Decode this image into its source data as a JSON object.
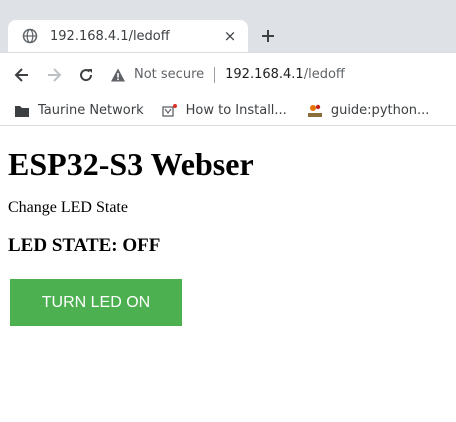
{
  "browser": {
    "tab": {
      "title": "192.168.4.1/ledoff",
      "close_glyph": "×",
      "icon": "globe-icon"
    },
    "new_tab_icon": "plus-icon",
    "address": {
      "security_label": "Not secure",
      "host": "192.168.4.1",
      "path": "/ledoff"
    },
    "bookmarks": [
      {
        "label": "Taurine Network",
        "icon": "folder-icon"
      },
      {
        "label": "How to Install...",
        "icon": "favicon-icon"
      },
      {
        "label": "guide:python...",
        "icon": "chpc-favicon-icon"
      }
    ]
  },
  "page": {
    "heading": "ESP32-S3 Webser",
    "subtitle": "Change LED State",
    "led_state": "LED STATE: OFF",
    "button_label": "TURN LED ON",
    "button_color": "#4caf50"
  }
}
